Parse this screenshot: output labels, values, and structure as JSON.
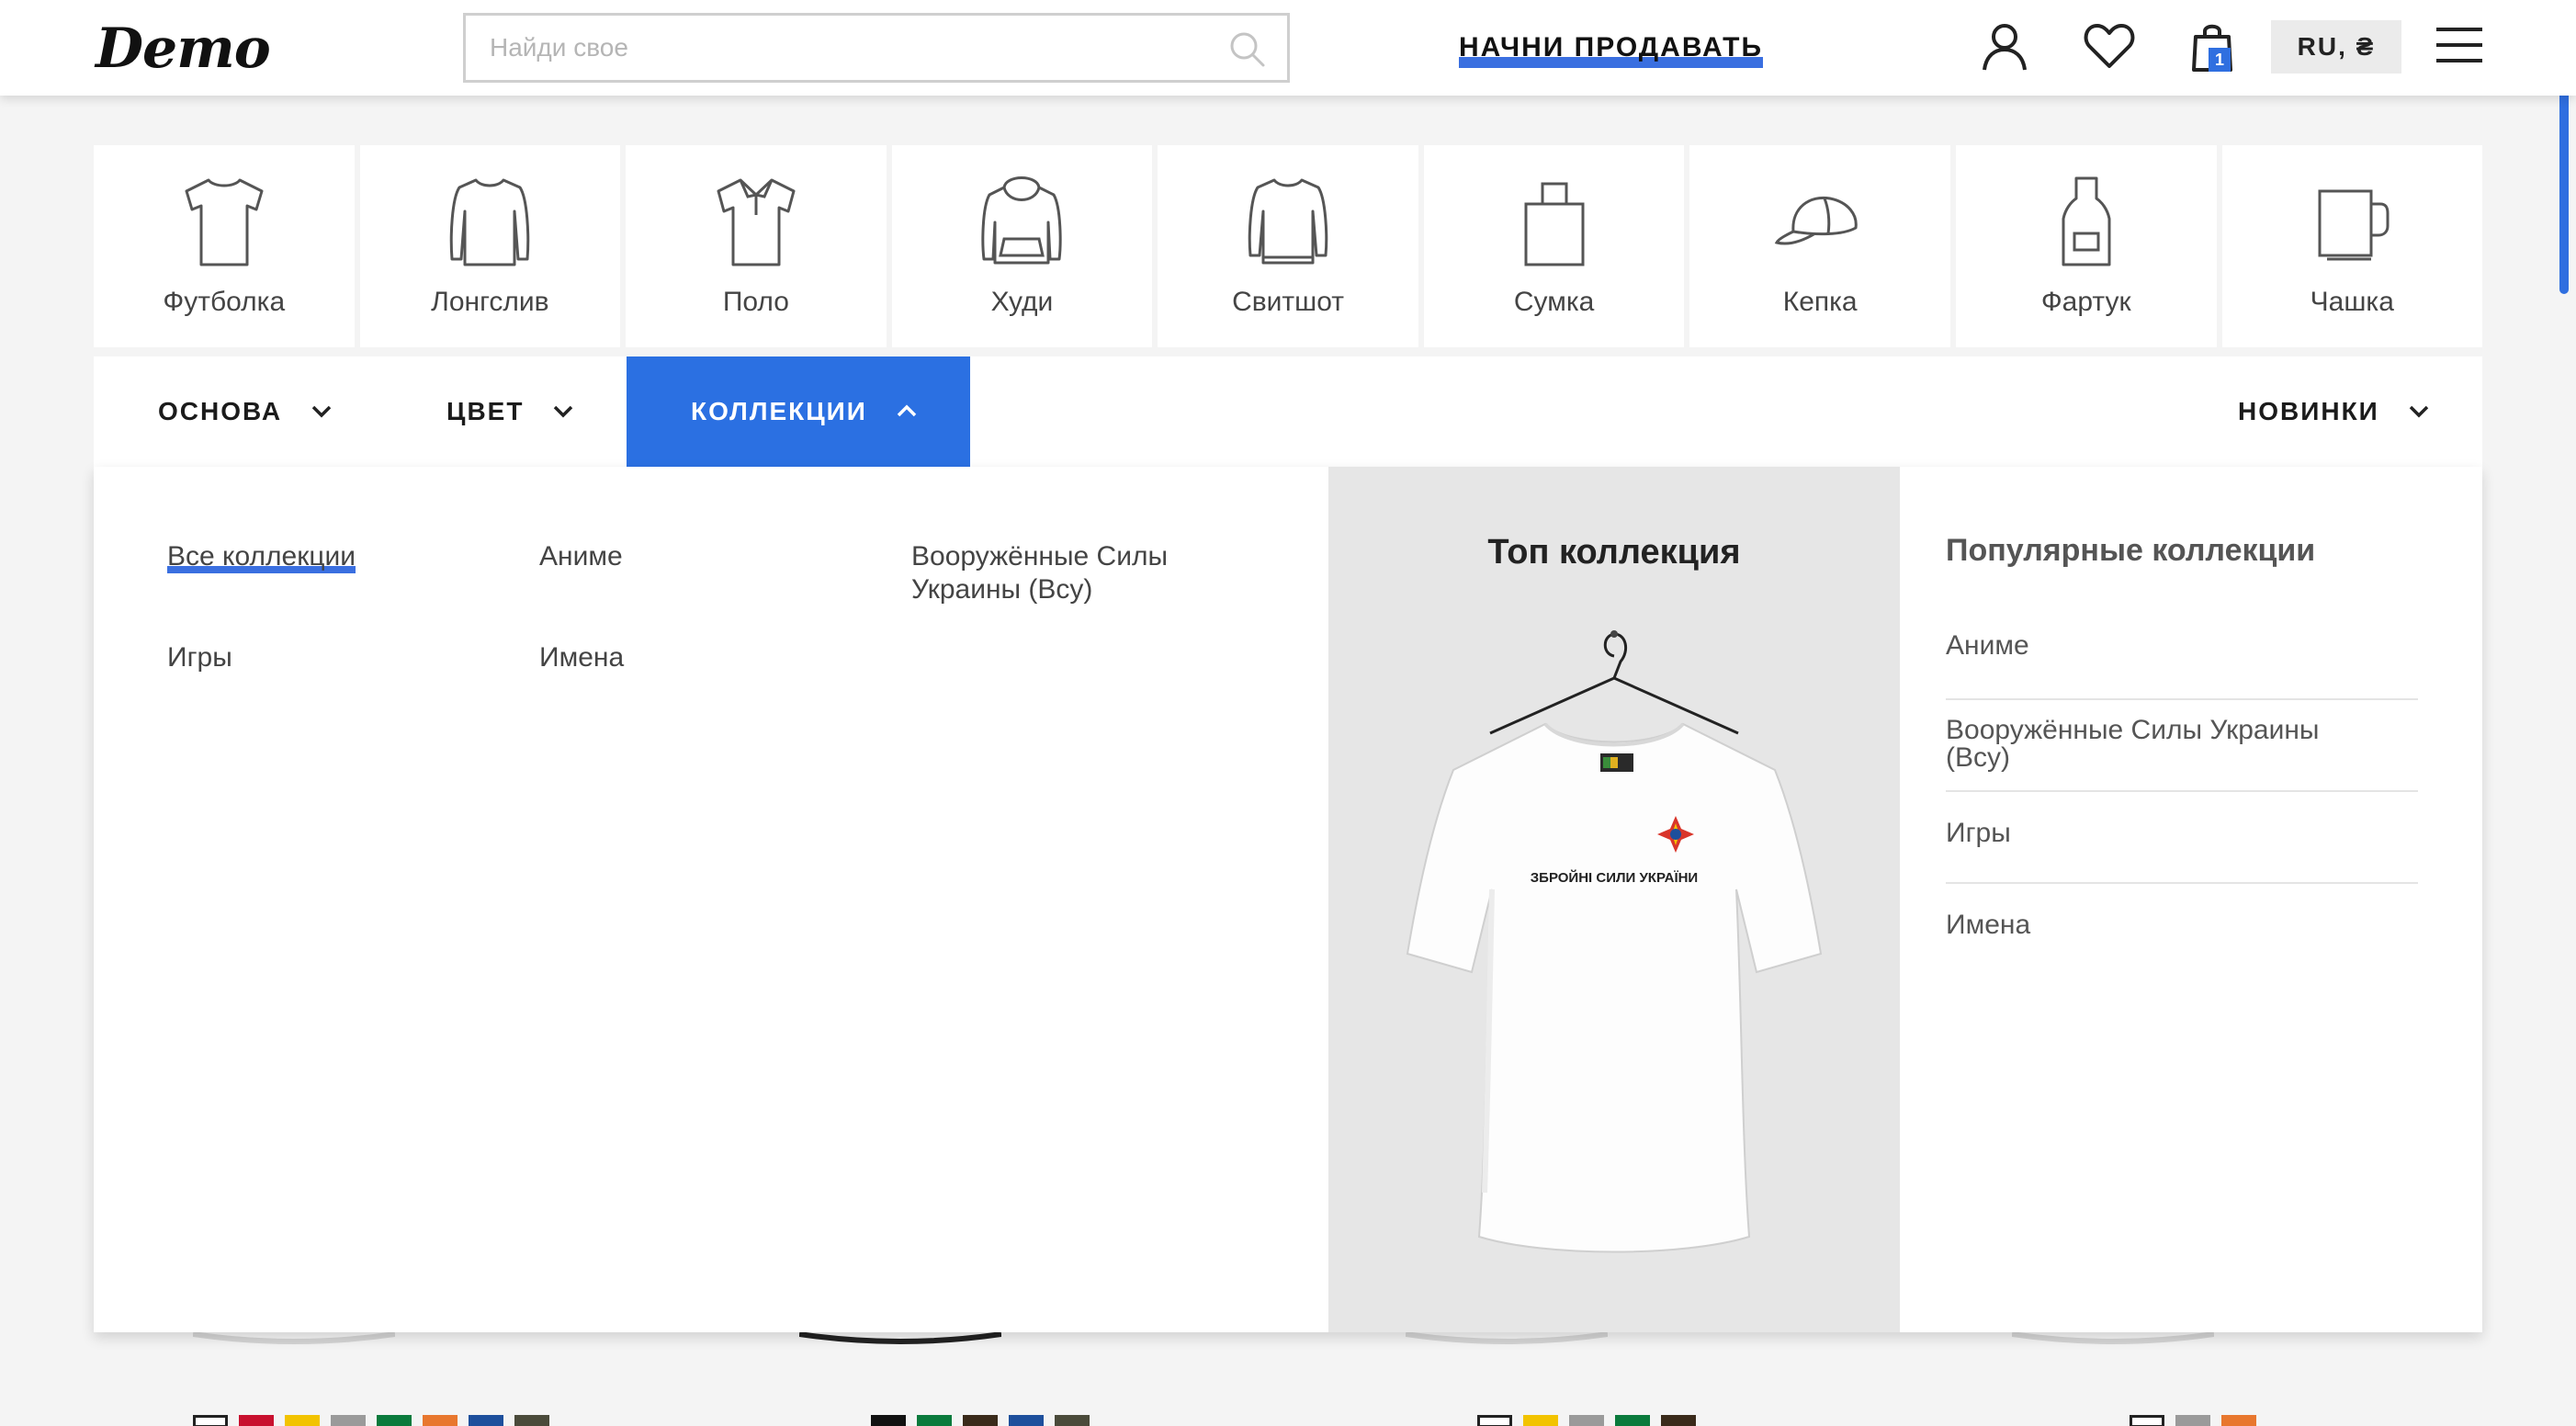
{
  "header": {
    "logo": "Demo",
    "search_placeholder": "Найди свое",
    "start_selling": "НАЧНИ ПРОДАВАТЬ",
    "cart_count": "1",
    "language": "RU, ₴"
  },
  "categories": [
    {
      "label": "Футболка",
      "icon": "tshirt-icon"
    },
    {
      "label": "Лонгслив",
      "icon": "longsleeve-icon"
    },
    {
      "label": "Поло",
      "icon": "polo-icon"
    },
    {
      "label": "Худи",
      "icon": "hoodie-icon"
    },
    {
      "label": "Свитшот",
      "icon": "sweatshirt-icon"
    },
    {
      "label": "Сумка",
      "icon": "bag-icon"
    },
    {
      "label": "Кепка",
      "icon": "cap-icon"
    },
    {
      "label": "Фартук",
      "icon": "apron-icon"
    },
    {
      "label": "Чашка",
      "icon": "mug-icon"
    }
  ],
  "filters": {
    "base": "ОСНОВА",
    "color": "ЦВЕТ",
    "collections": "КОЛЛЕКЦИИ",
    "sort": "НОВИНКИ"
  },
  "collections_menu": {
    "links": [
      "Все коллекции",
      "Аниме",
      "Вооружённые Силы Украины (Всу)",
      "Игры",
      "Имена"
    ],
    "top_collection_title": "Топ коллекция",
    "top_collection_print_text": "ЗБРОЙНІ СИЛИ УКРАЇНИ",
    "popular_title": "Популярные коллекции",
    "popular": [
      "Аниме",
      "Вооружённые Силы Украины (Всу)",
      "Игры",
      "Имена"
    ]
  },
  "colors": {
    "accent": "#2b70e2",
    "swatches_row": [
      "#ffffff",
      "#c8102e",
      "#f2c300",
      "#9a9a9a",
      "#0a7a3c",
      "#e8772e",
      "#1d4f9c",
      "#4a4a3a"
    ]
  }
}
